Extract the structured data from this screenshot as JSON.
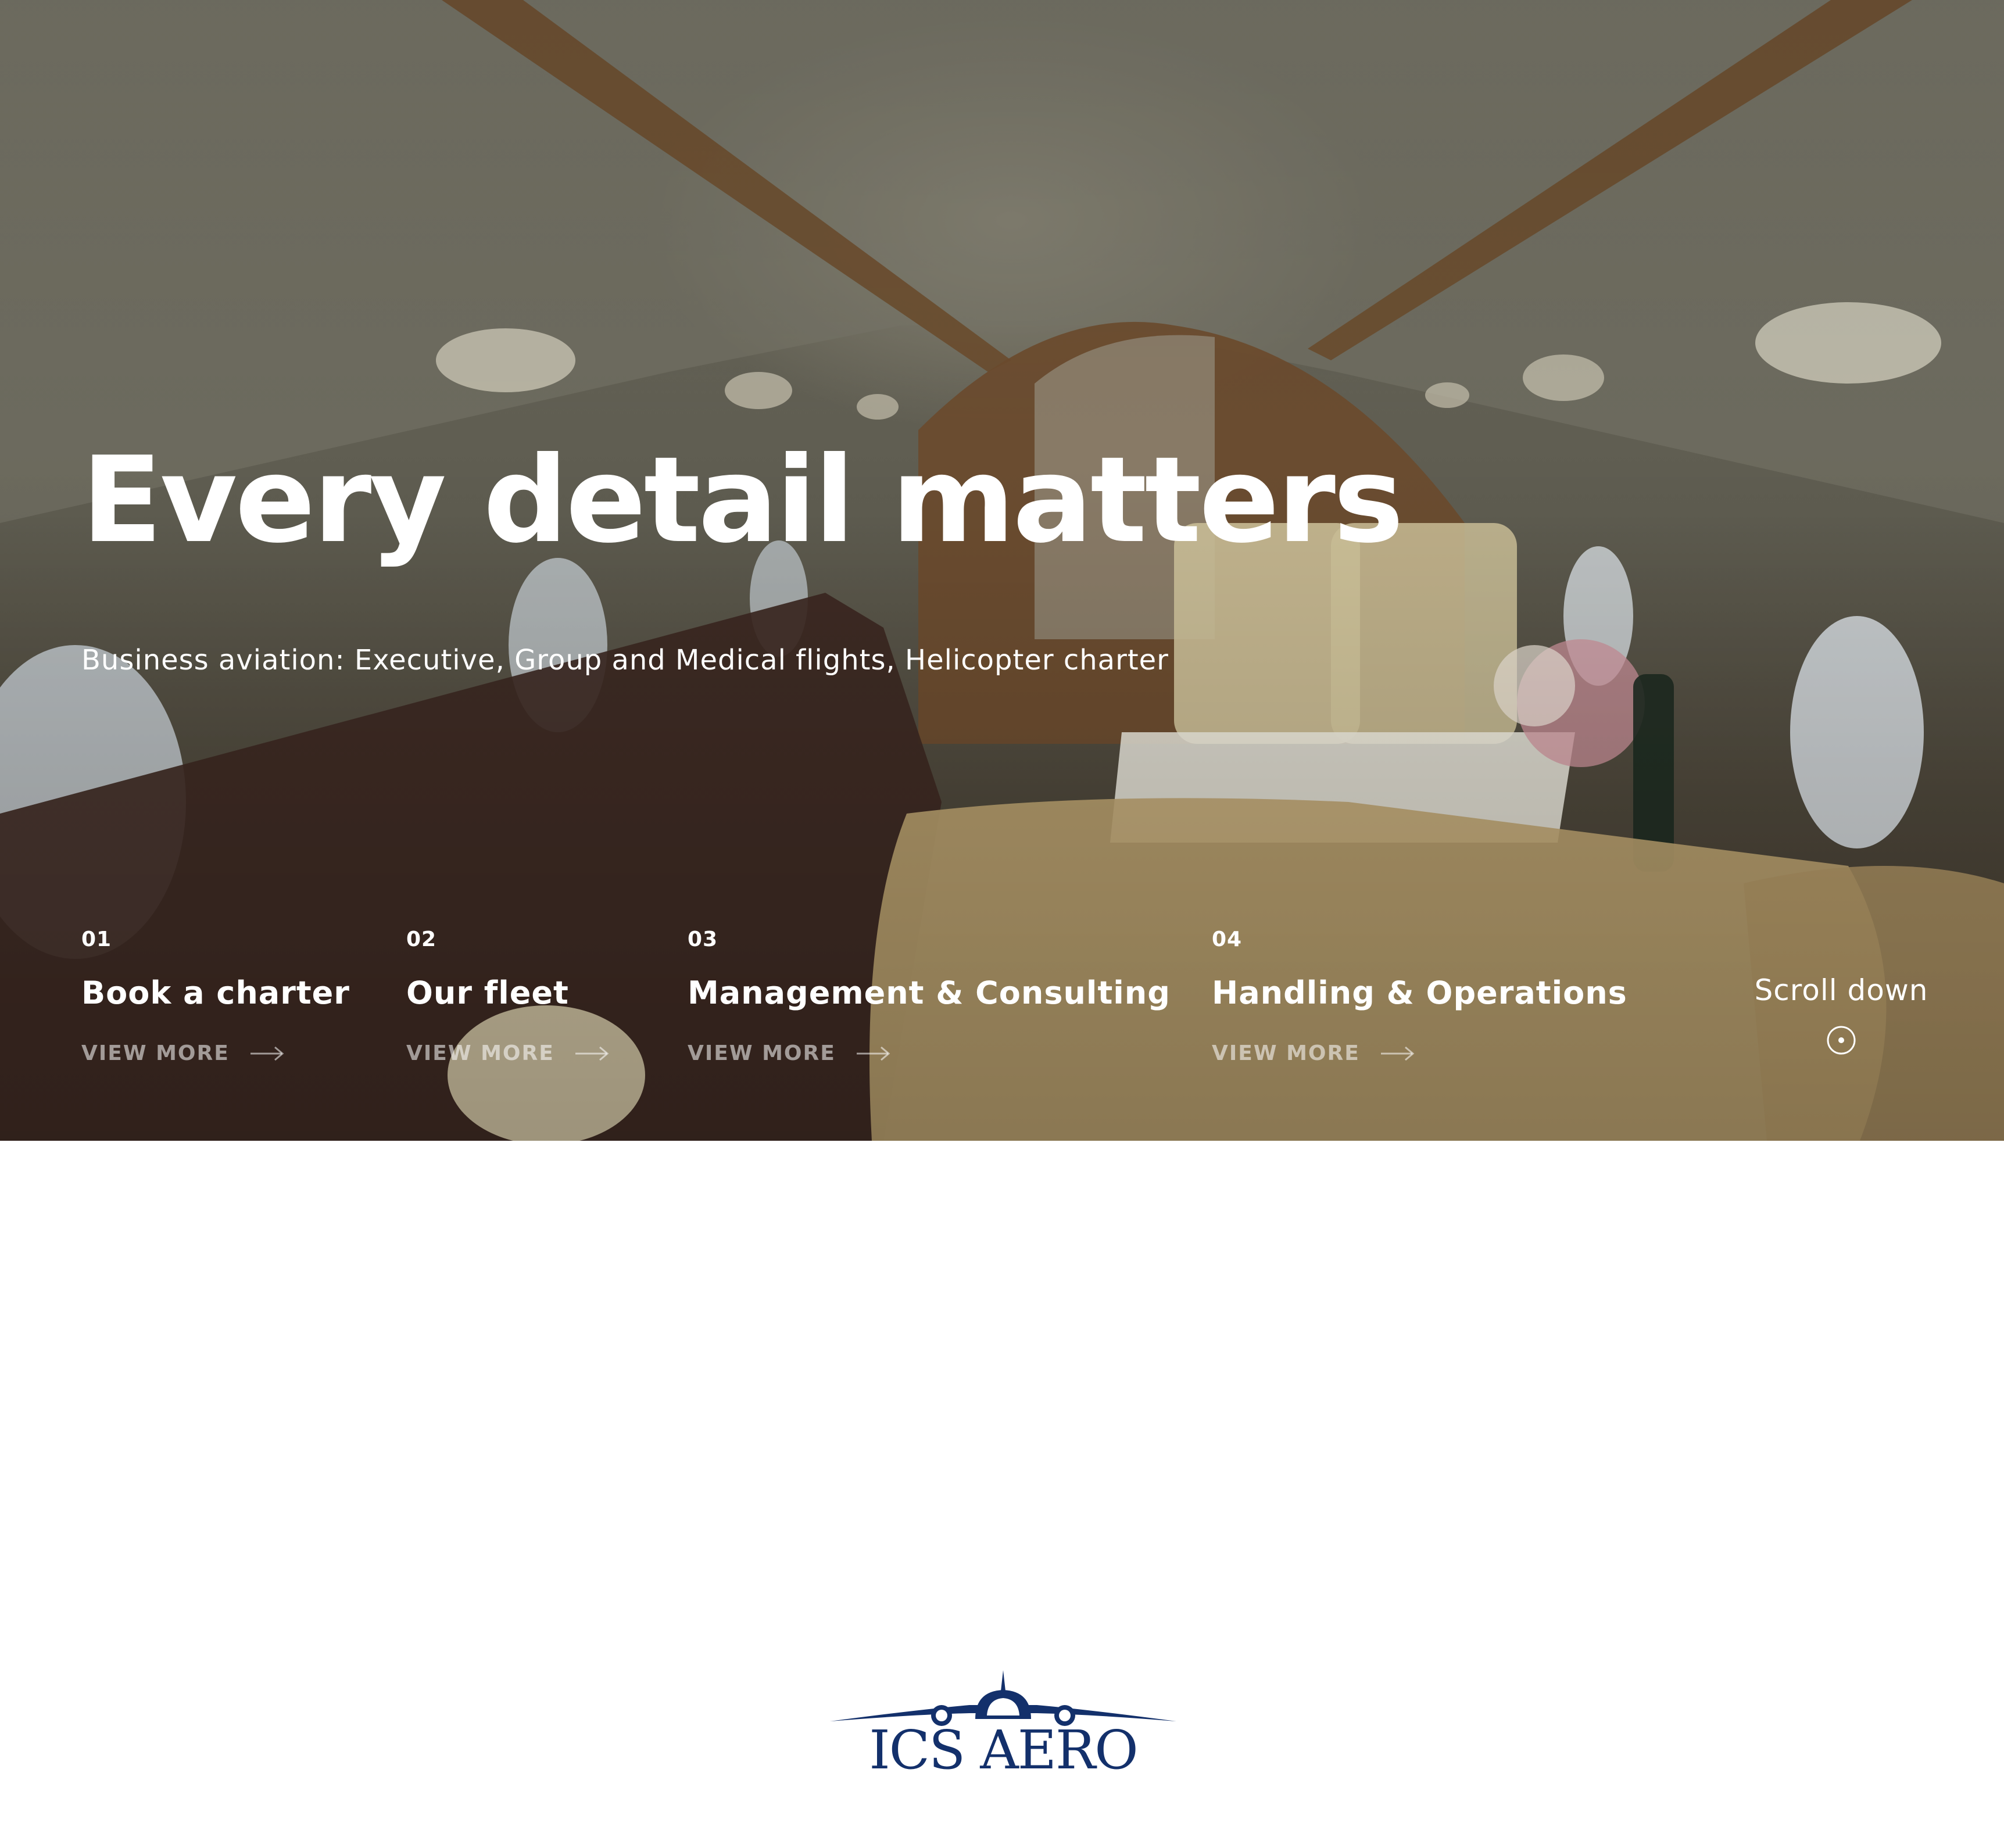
{
  "hero": {
    "title": "Every detail matters",
    "subtitle": "Business aviation: Executive, Group and Medical flights, Helicopter charter"
  },
  "services": [
    {
      "number": "01",
      "title": "Book a charter",
      "link_label": "VIEW MORE"
    },
    {
      "number": "02",
      "title": "Our fleet",
      "link_label": "VIEW MORE"
    },
    {
      "number": "03",
      "title": "Management & Consulting",
      "link_label": "VIEW MORE"
    },
    {
      "number": "04",
      "title": "Handling & Operations",
      "link_label": "VIEW MORE"
    }
  ],
  "scroll": {
    "label": "Scroll down",
    "icon": "scroll-circle-icon"
  },
  "logo": {
    "text": "ICS AERO",
    "icon": "airplane-front-icon",
    "color": "#13306b"
  },
  "colors": {
    "hero_text": "#ffffff",
    "link_muted": "rgba(255,255,255,0.55)",
    "page_background": "#ffffff"
  },
  "icons": {
    "link_arrow": "arrow-right-icon"
  }
}
